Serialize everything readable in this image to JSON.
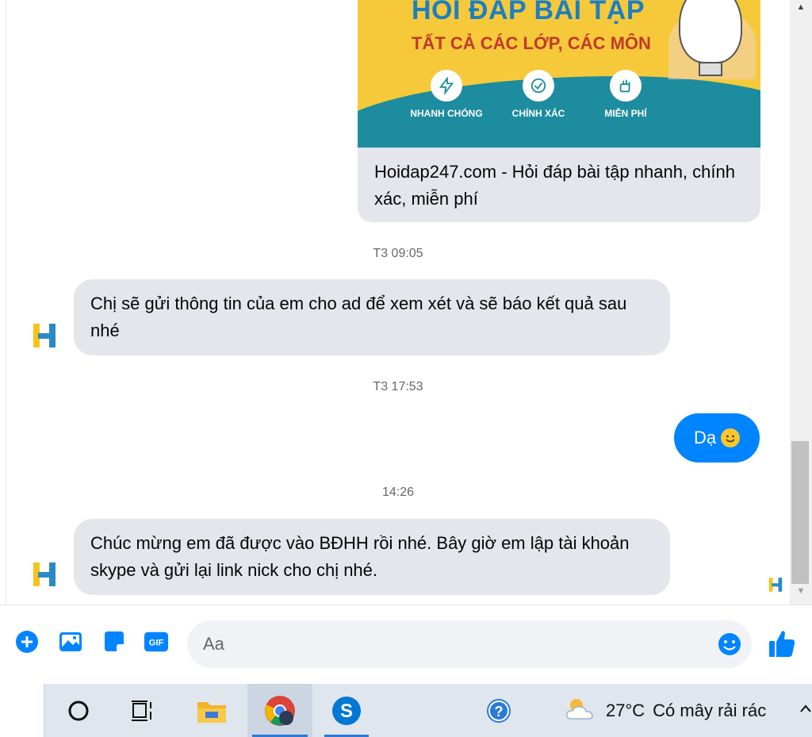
{
  "card": {
    "banner_title": "HỎI ĐÁP BÀI TẬP",
    "banner_subtitle": "TẤT CẢ CÁC LỚP, CÁC MÔN",
    "features": [
      "NHANH CHÓNG",
      "CHÍNH XÁC",
      "MIỄN PHÍ"
    ],
    "link_title": "Hoidap247.com - Hỏi đáp bài tập nhanh, chính xác, miễn phí"
  },
  "messages": {
    "ts1": "T3 09:05",
    "msg1": "Chị sẽ gửi thông tin của em cho ad để xem xét và sẽ báo kết quả sau nhé",
    "ts2": "T3 17:53",
    "reply": "Dạ",
    "ts3": "14:26",
    "msg2": "Chúc mừng em đã được vào BĐHH rồi nhé. Bây giờ em lập tài khoản skype và gửi lại link nick cho chị nhé."
  },
  "composer": {
    "placeholder": "Aa",
    "gif_label": "GIF"
  },
  "taskbar": {
    "temperature": "27°C",
    "condition": "Có mây rải rác",
    "skype_letter": "S"
  },
  "colors": {
    "accent": "#0084ff",
    "bubble_in": "#e4e6eb",
    "banner_yellow": "#f6c93a",
    "banner_teal": "#1d8c9e"
  },
  "icons": [
    "add-icon",
    "image-icon",
    "sticker-icon",
    "gif-icon",
    "emoji-icon",
    "like-icon",
    "cortana-icon",
    "task-view-icon",
    "file-explorer-icon",
    "chrome-icon",
    "skype-icon",
    "help-icon",
    "weather-icon",
    "chevron-up-icon"
  ]
}
